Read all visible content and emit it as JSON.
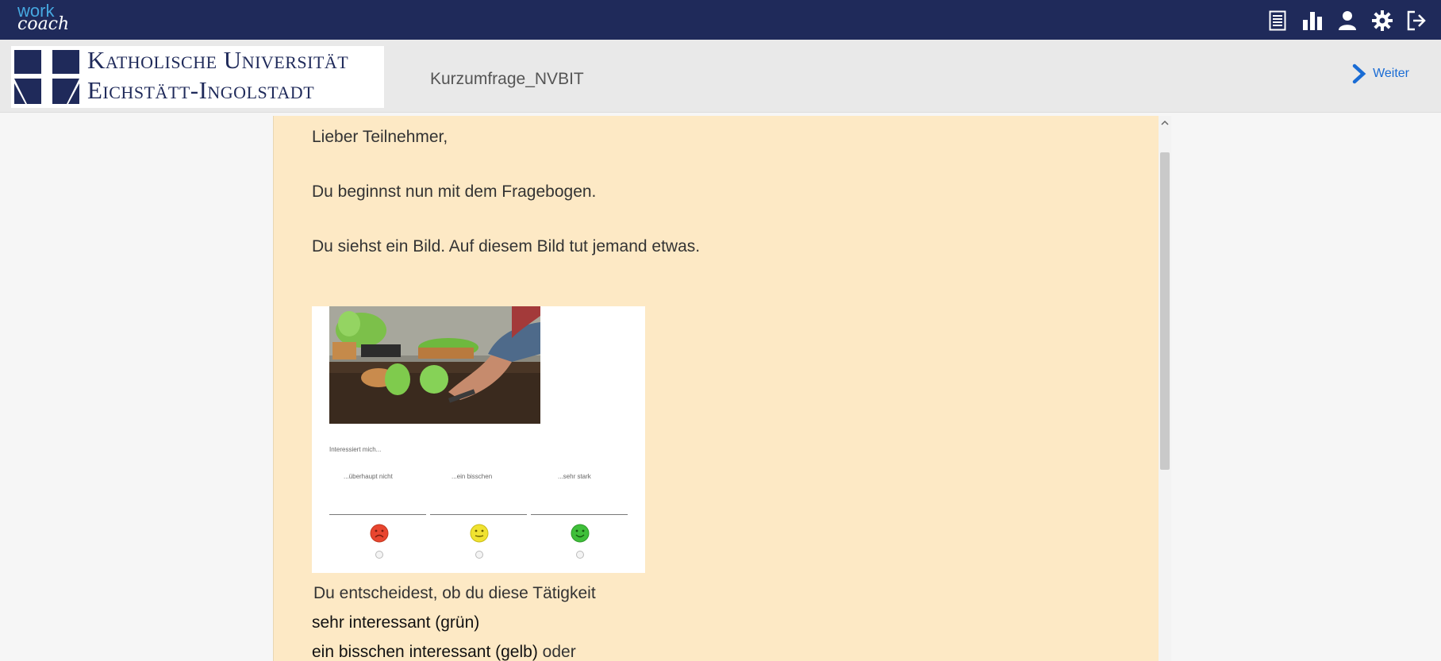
{
  "app": {
    "brand_top": "work",
    "brand_bottom": "coach",
    "top_icons": [
      "document-icon",
      "bar-chart-icon",
      "user-icon",
      "gear-icon",
      "logout-icon"
    ]
  },
  "header": {
    "logo_line1": "Katholische Universität",
    "logo_line2": "Eichstätt-Ingolstadt",
    "survey_title": "Kurzumfrage_NVBIT",
    "next_label": "Weiter"
  },
  "content": {
    "greeting": "Lieber Teilnehmer,",
    "line1": "Du beginnst nun mit dem Fragebogen.",
    "line2": "Du siehst ein Bild. Auf diesem Bild tut jemand etwas.",
    "image": {
      "prompt": "Interessiert mich...",
      "options": [
        "...überhaupt nicht",
        "...ein bisschen",
        "...sehr stark"
      ]
    },
    "line3": "Du entscheidest, ob du diese Tätigkeit",
    "line4": "sehr interessant (grün)",
    "line5_bold": "ein bisschen interessant (gelb)",
    "line5_rest": " oder"
  },
  "colors": {
    "navbar": "#1f2a5a",
    "accent": "#1a6cd4",
    "panel": "#fde9c5",
    "sad": "#e8452f",
    "neutral": "#f0e230",
    "happy": "#3fbf3a"
  }
}
